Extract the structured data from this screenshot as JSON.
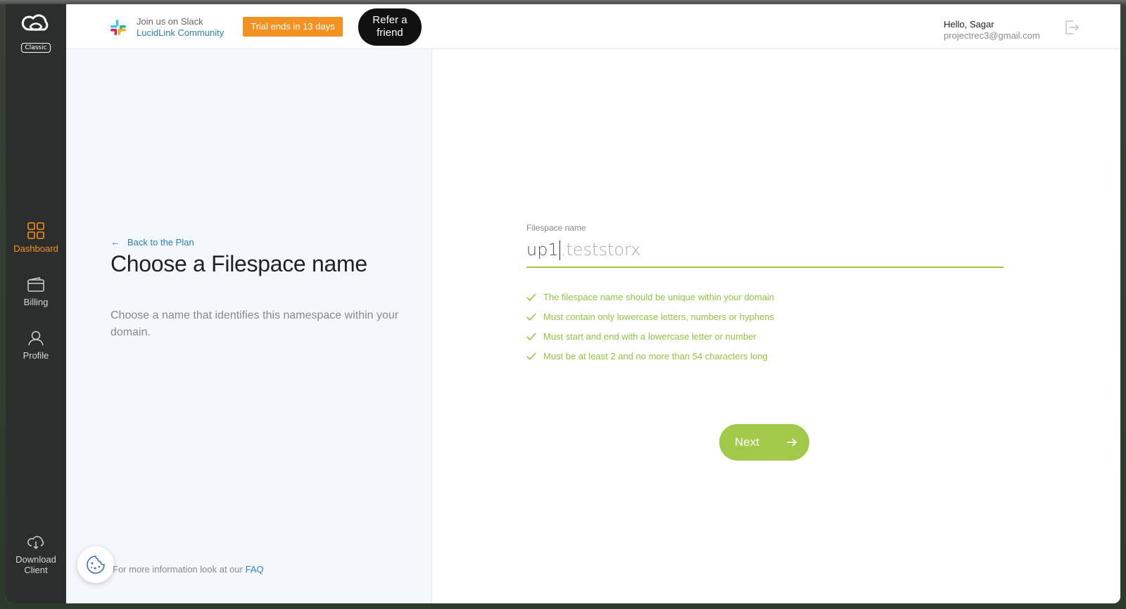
{
  "sidebar": {
    "logo_badge": "Classic",
    "items": [
      {
        "label": "Dashboard",
        "icon": "grid-icon",
        "active": true
      },
      {
        "label": "Billing",
        "icon": "wallet-icon",
        "active": false
      },
      {
        "label": "Profile",
        "icon": "user-icon",
        "active": false
      }
    ],
    "download": {
      "label_line1": "Download",
      "label_line2": "Client",
      "icon": "cloud-download-icon"
    }
  },
  "topbar": {
    "slack_line1": "Join us on Slack",
    "slack_line2": "LucidLink Community",
    "trial_badge": "Trial ends in 13 days",
    "refer_line1": "Refer a",
    "refer_line2": "friend",
    "user_greeting": "Hello, Sagar",
    "user_email": "projectrec3@gmail.com"
  },
  "left": {
    "back_link": "Back to the Plan",
    "title": "Choose a Filespace name",
    "description": "Choose a name that identifies this namespace within your domain.",
    "faq_prefix": "For more information look at our",
    "faq_link": "FAQ"
  },
  "form": {
    "label": "Filespace name",
    "value": "up1",
    "suffix": ".teststorx",
    "rules": [
      "The filespace name should be unique within your domain",
      "Must contain only lowercase letters, numbers or hyphens",
      "Must start and end with a lowercase letter or number",
      "Must be at least 2 and no more than 54 characters long"
    ],
    "next_label": "Next"
  },
  "colors": {
    "accent_orange": "#f39221",
    "accent_green": "#a3c94a",
    "link_blue": "#2d7fc1",
    "sidebar_bg": "#2b2e2c"
  }
}
